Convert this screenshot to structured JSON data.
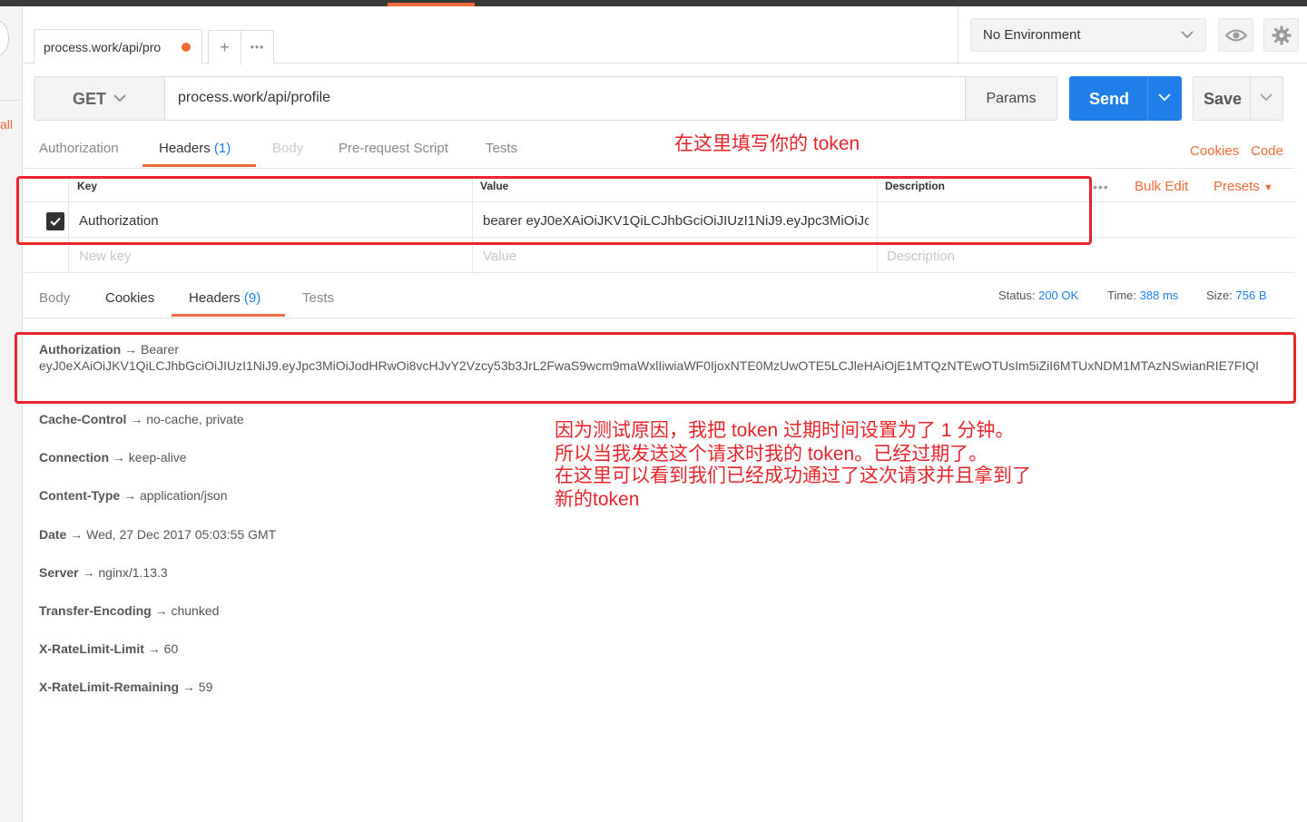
{
  "sidebar": {
    "partial_label": "all"
  },
  "tab": {
    "title": "process.work/api/pro",
    "add_label": "+",
    "more_label": "•••"
  },
  "environment": {
    "selected": "No Environment"
  },
  "request": {
    "method": "GET",
    "url": "process.work/api/profile",
    "params_label": "Params",
    "send_label": "Send",
    "save_label": "Save"
  },
  "request_tabs": {
    "authorization": "Authorization",
    "headers": "Headers",
    "headers_count": "(1)",
    "body": "Body",
    "prerequest": "Pre-request Script",
    "tests": "Tests",
    "cookies": "Cookies",
    "code": "Code"
  },
  "annotations": {
    "token_hint": "在这里填写你的 token",
    "explanation_1": "因为测试原因，我把 token 过期时间设置为了 1 分钟。",
    "explanation_2": "所以当我发送这个请求时我的 token。已经过期了。",
    "explanation_3": "在这里可以看到我们已经成功通过了这次请求并且拿到了",
    "explanation_4": "新的token"
  },
  "headers_table": {
    "col_key": "Key",
    "col_value": "Value",
    "col_description": "Description",
    "bulk_edit": "Bulk Edit",
    "presets": "Presets",
    "rows": [
      {
        "key": "Authorization",
        "value": "bearer eyJ0eXAiOiJKV1QiLCJhbGciOiJIUzI1NiJ9.eyJpc3MiOiJo...",
        "description": ""
      }
    ],
    "new_key_placeholder": "New key",
    "new_value_placeholder": "Value",
    "new_description_placeholder": "Description"
  },
  "response": {
    "tabs": {
      "body": "Body",
      "cookies": "Cookies",
      "headers": "Headers",
      "headers_count": "(9)",
      "tests": "Tests"
    },
    "status_label": "Status:",
    "status_value": "200 OK",
    "time_label": "Time:",
    "time_value": "388 ms",
    "size_label": "Size:",
    "size_value": "756 B",
    "arrow": "→",
    "authorization": {
      "key": "Authorization",
      "prefix": "Bearer",
      "value": "eyJ0eXAiOiJKV1QiLCJhbGciOiJIUzI1NiJ9.eyJpc3MiOiJodHRwOi8vcHJvY2Vzcy53b3JrL2FwaS9wcm9maWxlIiwiaWF0IjoxNTE0MzUwOTE5LCJleHAiOjE1MTQzNTEwOTUsIm5iZiI6MTUxNDM1MTAzNSwianRIE7FIQI"
    },
    "headers": [
      {
        "key": "Cache-Control",
        "value": "no-cache, private"
      },
      {
        "key": "Connection",
        "value": "keep-alive"
      },
      {
        "key": "Content-Type",
        "value": "application/json"
      },
      {
        "key": "Date",
        "value": "Wed, 27 Dec 2017 05:03:55 GMT"
      },
      {
        "key": "Server",
        "value": "nginx/1.13.3"
      },
      {
        "key": "Transfer-Encoding",
        "value": "chunked"
      },
      {
        "key": "X-RateLimit-Limit",
        "value": "60"
      },
      {
        "key": "X-RateLimit-Remaining",
        "value": "59"
      }
    ]
  },
  "colors": {
    "accent": "#f26b3a",
    "primary": "#1f7ee8",
    "annotation": "#e8252b"
  }
}
